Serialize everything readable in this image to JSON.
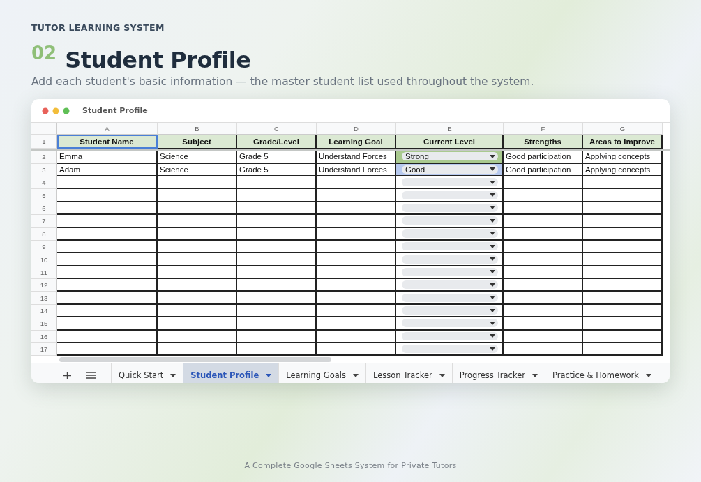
{
  "eyebrow": "TUTOR LEARNING SYSTEM",
  "section_number": "02",
  "title": "Student Profile",
  "subtitle": "Add each student's basic information — the master student list used throughout the system.",
  "window": {
    "title": "Student Profile"
  },
  "sheet": {
    "columns": [
      {
        "letter": "A",
        "header": "Student Name",
        "kind": "text"
      },
      {
        "letter": "B",
        "header": "Subject",
        "kind": "text"
      },
      {
        "letter": "C",
        "header": "Grade/Level",
        "kind": "text"
      },
      {
        "letter": "D",
        "header": "Learning Goal",
        "kind": "text"
      },
      {
        "letter": "E",
        "header": "Current Level",
        "kind": "dropdown"
      },
      {
        "letter": "F",
        "header": "Strengths",
        "kind": "text"
      },
      {
        "letter": "G",
        "header": "Areas to Improve",
        "kind": "text"
      }
    ],
    "header_row_number": "1",
    "rows": [
      {
        "number": "2",
        "cells": [
          "Emma",
          "Science",
          "Grade 5",
          "Understand Forces",
          "Strong",
          "Good participation",
          "Applying concepts"
        ],
        "color": "#a9c98f"
      },
      {
        "number": "3",
        "cells": [
          "Adam",
          "Science",
          "Grade 5",
          "Understand Forces",
          "Good",
          "Good participation",
          "Applying concepts"
        ],
        "color": "#b7c9ef"
      },
      {
        "number": "4"
      },
      {
        "number": "5"
      },
      {
        "number": "6"
      },
      {
        "number": "7"
      },
      {
        "number": "8"
      },
      {
        "number": "9"
      },
      {
        "number": "10"
      },
      {
        "number": "11"
      },
      {
        "number": "12"
      },
      {
        "number": "13"
      },
      {
        "number": "14"
      },
      {
        "number": "15"
      },
      {
        "number": "16"
      },
      {
        "number": "17"
      }
    ]
  },
  "sheet_tabs": [
    {
      "label": "Quick Start",
      "selected": false
    },
    {
      "label": "Student Profile",
      "selected": true
    },
    {
      "label": "Learning Goals",
      "selected": false
    },
    {
      "label": "Lesson Tracker",
      "selected": false
    },
    {
      "label": "Progress Tracker",
      "selected": false
    },
    {
      "label": "Practice & Homework",
      "selected": false
    }
  ],
  "footer": "A Complete Google Sheets System for Private Tutors"
}
